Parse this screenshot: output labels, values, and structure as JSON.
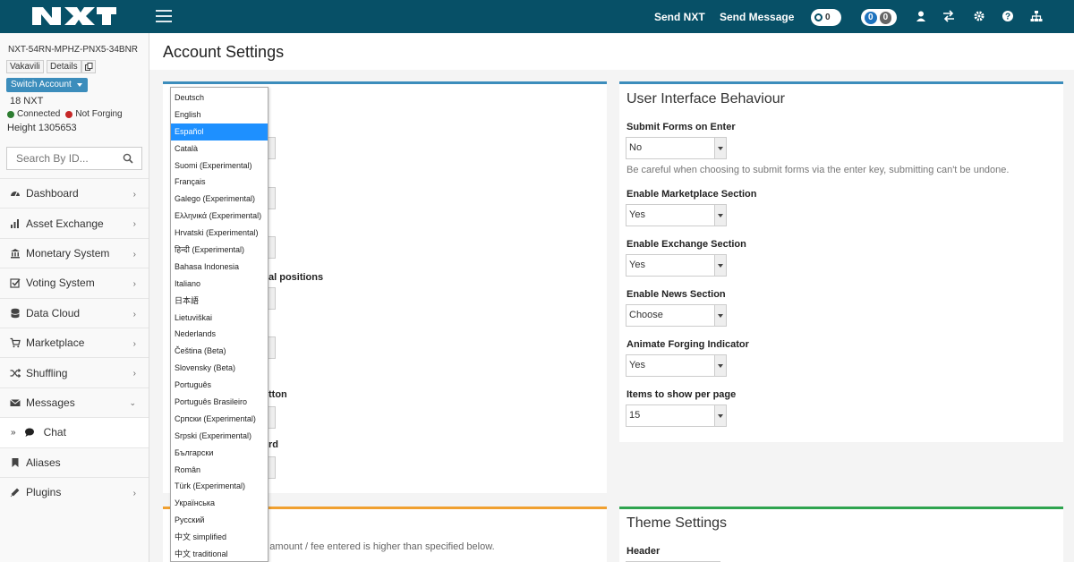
{
  "topbar": {
    "send_nxt": "Send NXT",
    "send_message": "Send Message",
    "pill1_count": "0",
    "pill2_a": "0",
    "pill2_b": "0",
    "icons": [
      "user-icon",
      "exchange-icon",
      "gear-icon",
      "question-icon",
      "sitemap-icon"
    ]
  },
  "sidebar": {
    "account_id": "NXT-54RN-MPHZ-PNX5-34BNR",
    "btn_vakavili": "Vakavili",
    "btn_details": "Details",
    "switch_account": "Switch Account",
    "balance": "18  NXT",
    "connected": "Connected",
    "not_forging": "Not Forging",
    "height": "Height 1305653",
    "search_placeholder": "Search By ID...",
    "connected_color": "#2e7d32",
    "forging_color": "#c62828",
    "nav": [
      {
        "label": "Dashboard",
        "icon": "dashboard-icon"
      },
      {
        "label": "Asset Exchange",
        "icon": "bar-chart-icon"
      },
      {
        "label": "Monetary System",
        "icon": "bank-icon"
      },
      {
        "label": "Voting System",
        "icon": "checkbox-icon"
      },
      {
        "label": "Data Cloud",
        "icon": "database-icon"
      },
      {
        "label": "Marketplace",
        "icon": "cart-icon"
      },
      {
        "label": "Shuffling",
        "icon": "shuffle-icon"
      },
      {
        "label": "Messages",
        "icon": "envelope-icon"
      },
      {
        "label": "Chat",
        "icon": "chat-icon"
      },
      {
        "label": "Aliases",
        "icon": "bookmark-icon"
      },
      {
        "label": "Plugins",
        "icon": "puzzle-icon"
      }
    ]
  },
  "main": {
    "title": "Account Settings",
    "left_partial": {
      "label1": "al positions",
      "label2": "tton",
      "label3": "rd",
      "text1": "an amount / fee entered is higher than specified below."
    },
    "ui_box": {
      "title": "User Interface Behaviour",
      "fields": [
        {
          "label": "Submit Forms on Enter",
          "value": "No"
        },
        {
          "label": "Enable Marketplace Section",
          "value": "Yes"
        },
        {
          "label": "Enable Exchange Section",
          "value": "Yes"
        },
        {
          "label": "Enable News Section",
          "value": "Choose"
        },
        {
          "label": "Animate Forging Indicator",
          "value": "Yes"
        },
        {
          "label": "Items to show per page",
          "value": "15"
        }
      ],
      "help": "Be careful when choosing to submit forms via the enter key, submitting can't be undone."
    },
    "theme_box": {
      "title": "Theme Settings",
      "header_label": "Header"
    }
  },
  "dropdown": {
    "selected": "Español",
    "options": [
      "Deutsch",
      "English",
      "Español",
      "Català",
      "Suomi (Experimental)",
      "Français",
      "Galego (Experimental)",
      "Ελληνικά (Experimental)",
      "Hrvatski (Experimental)",
      "हिन्दी (Experimental)",
      "Bahasa Indonesia",
      "Italiano",
      "日本語",
      "Lietuviškai",
      "Nederlands",
      "Čeština (Beta)",
      "Slovensky (Beta)",
      "Português",
      "Português Brasileiro",
      "Српски (Experimental)",
      "Srpski (Experimental)",
      "Български",
      "Român",
      "Türk (Experimental)",
      "Українська",
      "Русский",
      "中文 simplified",
      "中文 traditional"
    ]
  },
  "colors": {
    "topbar": "#075067",
    "accent": "#3c8dbc",
    "selected_option": "#1e90ff"
  }
}
